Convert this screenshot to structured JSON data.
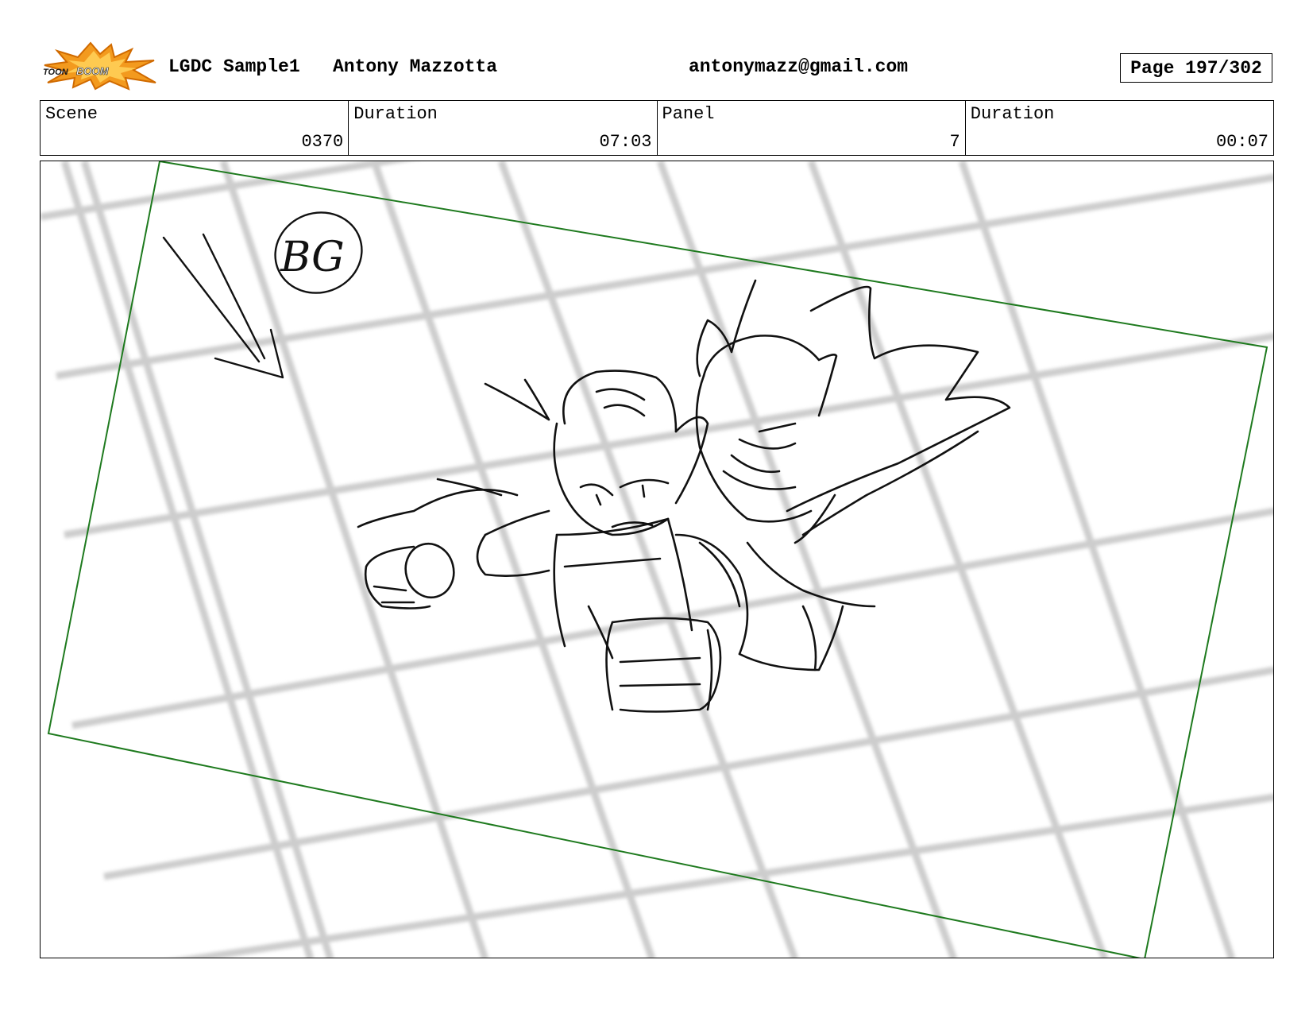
{
  "header": {
    "logo": {
      "text_top": "TOON",
      "text_main": "BOOM",
      "icon": "toon-boom-logo-icon",
      "colors": {
        "burst": "#f39a1e",
        "burst_dark": "#d06a00",
        "text": "#1a1a1a"
      }
    },
    "project": "LGDC Sample1",
    "author": "Antony Mazzotta",
    "email": "antonymazz@gmail.com",
    "page": "Page 197/302"
  },
  "info": {
    "scene_label": "Scene",
    "scene_value": "0370",
    "scene_duration_label": "Duration",
    "scene_duration_value": "07:03",
    "panel_label": "Panel",
    "panel_value": "7",
    "panel_duration_label": "Duration",
    "panel_duration_value": "00:07"
  },
  "panel_art": {
    "bg_note": "BG",
    "camera_frame_color": "#1e7a1e",
    "grid_color": "#c8c8c8"
  }
}
